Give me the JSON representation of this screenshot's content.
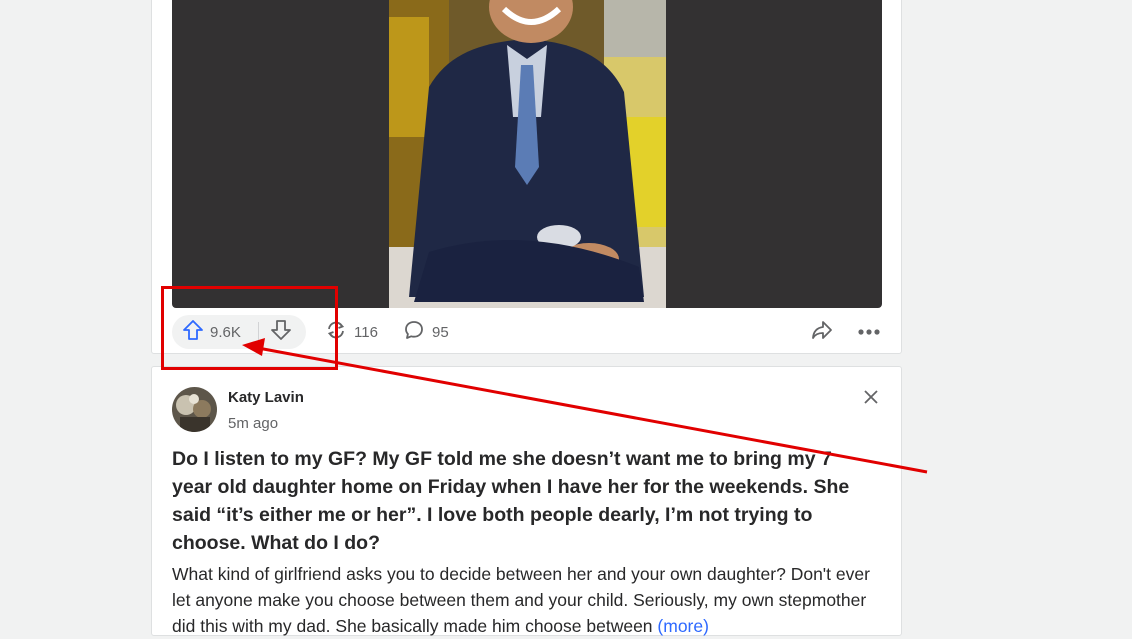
{
  "post_top": {
    "upvotes": "9.6K",
    "shares": "116",
    "comments": "95",
    "icons": {
      "upvote": "arrow-up-icon",
      "downvote": "arrow-down-icon",
      "share": "reshare-icon",
      "comment": "comment-bubble-icon",
      "forward": "forward-arrow-icon",
      "more": "more-dots-icon"
    }
  },
  "post_bottom": {
    "author": "Katy Lavin",
    "time": "5m ago",
    "question": "Do I listen to my GF? My GF told me she doesn’t want me to bring my 7 year old daughter home on Friday when I have her for the weekends. She said “it’s either me or her”. I love both people dearly, I’m not trying to choose. What do I do?",
    "answer": "What kind of girlfriend asks you to decide between her and your own daughter? Don't ever let anyone make you choose between them and your child. Seriously, my own stepmother did this with my dad. She basically made him choose between",
    "more_label": "(more)",
    "icons": {
      "close": "close-icon",
      "avatar": "avatar"
    }
  },
  "colors": {
    "upvote_accent": "#2e69ff",
    "annotation_red": "#e10000",
    "background": "#f1f2f2"
  }
}
